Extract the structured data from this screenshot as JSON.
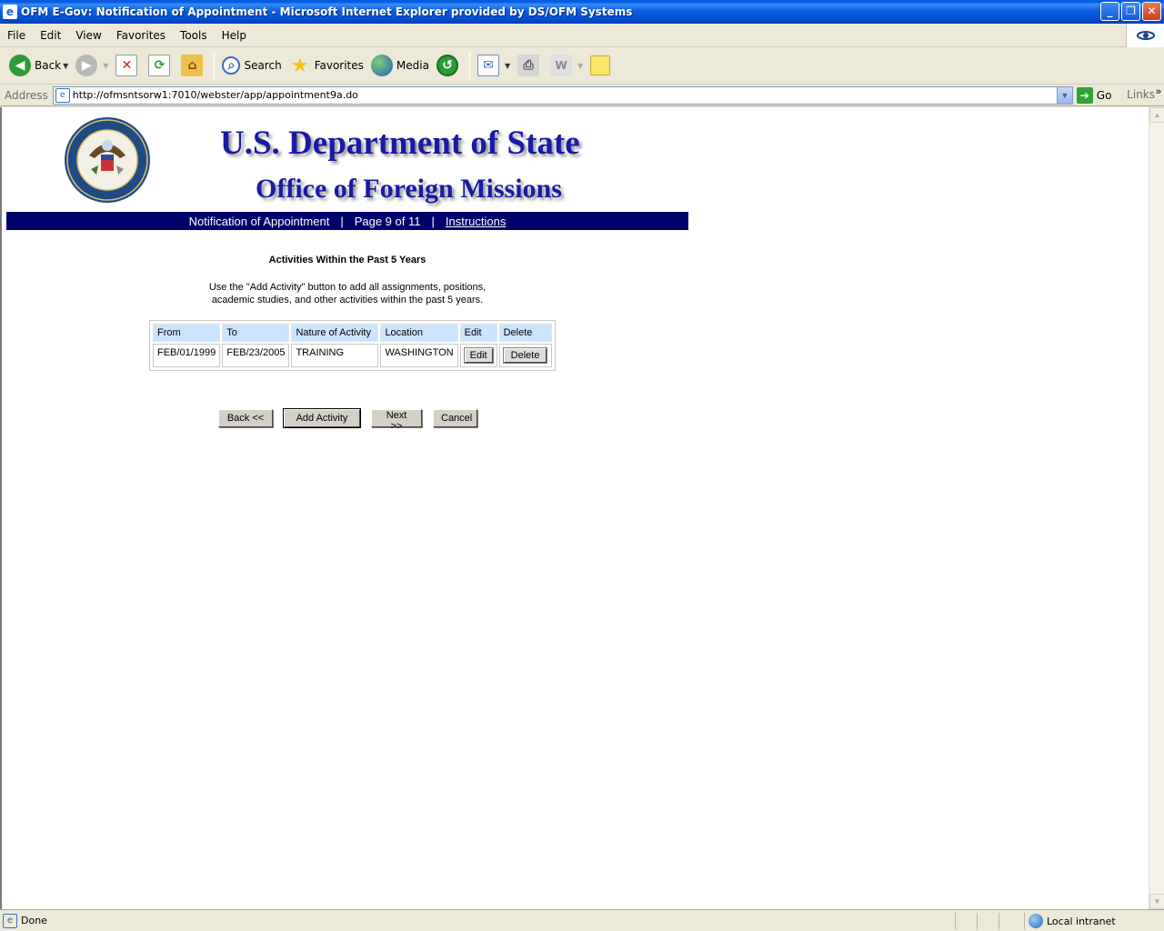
{
  "window": {
    "title": "OFM E-Gov: Notification of Appointment - Microsoft Internet Explorer provided by DS/OFM Systems"
  },
  "menu": [
    "File",
    "Edit",
    "View",
    "Favorites",
    "Tools",
    "Help"
  ],
  "toolbar": {
    "back_label": "Back",
    "search_label": "Search",
    "favorites_label": "Favorites",
    "media_label": "Media"
  },
  "address": {
    "label": "Address",
    "url": "http://ofmsntsorw1:7010/webster/app/appointment9a.do",
    "go_label": "Go",
    "links_label": "Links"
  },
  "header": {
    "dept": "U.S. Department of State",
    "office": "Office of Foreign Missions"
  },
  "nav": {
    "form_name": "Notification of Appointment",
    "sep": "|",
    "page": "Page 9 of 11",
    "instructions": "Instructions"
  },
  "section": {
    "title": "Activities Within the Past 5 Years",
    "instructions_line1": "Use the \"Add Activity\" button to add all assignments, positions,",
    "instructions_line2": "academic studies, and other activities within the past 5 years."
  },
  "table": {
    "headers": [
      "From",
      "To",
      "Nature of Activity",
      "Location",
      "Edit",
      "Delete"
    ],
    "rows": [
      {
        "from": "FEB/01/1999",
        "to": "FEB/23/2005",
        "nature": "TRAINING",
        "location": "WASHINGTON",
        "edit_label": "Edit",
        "delete_label": "Delete"
      }
    ]
  },
  "buttons": {
    "back": "Back <<",
    "add": "Add Activity",
    "next": "Next >>",
    "cancel": "Cancel"
  },
  "status": {
    "text": "Done",
    "zone": "Local intranet"
  },
  "colors": {
    "header_text": "#1a1aa6",
    "nav_bar": "#00006b",
    "table_header": "#cce4ff"
  }
}
